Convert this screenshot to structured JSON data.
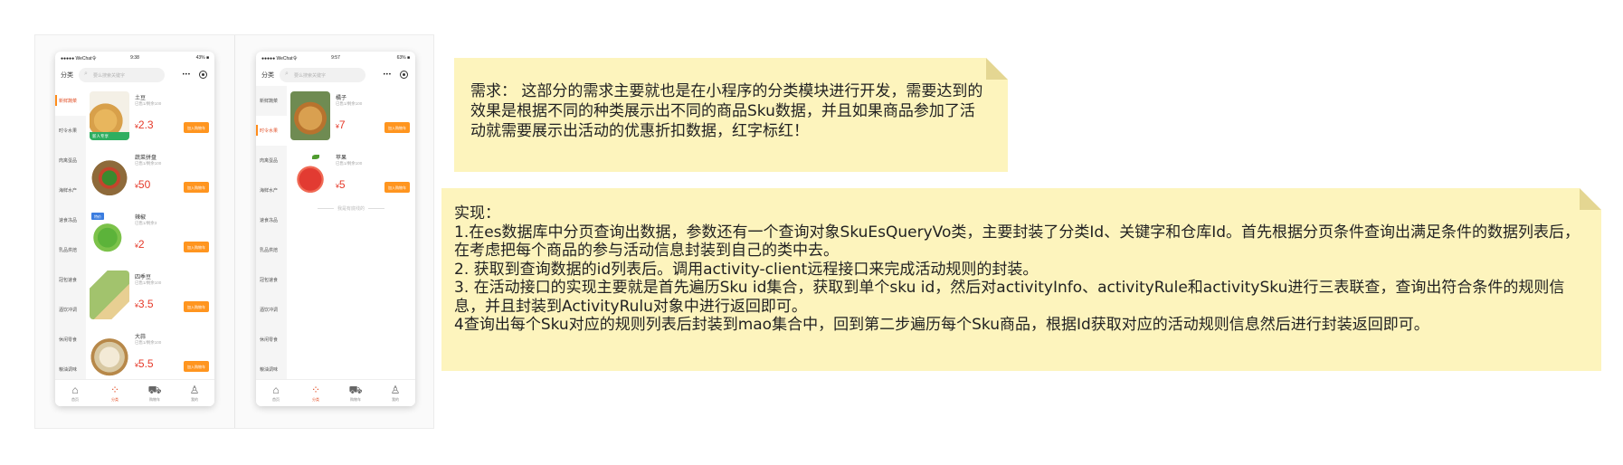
{
  "phones": [
    {
      "status": {
        "carrier": "●●●●● WeChat令",
        "time": "9:38",
        "battery": "43% ■"
      },
      "category_title": "分类",
      "search_placeholder": "要么搜索关键字",
      "capsule_dots": "•••",
      "categories": [
        "新鲜蔬菜",
        "时令水果",
        "肉禽蛋品",
        "海鲜水产",
        "速食冻品",
        "乳品烘焙",
        "冠包速食",
        "酒饮冲调",
        "休闲零食",
        "粮油调味"
      ],
      "active_category_index": 0,
      "products": [
        {
          "name": "土豆",
          "sold": "已售1/剩余100",
          "price": "2.3",
          "tag": "新人专享",
          "img": "img-potato"
        },
        {
          "name": "蔬菜拼盘",
          "sold": "已售1/剩余100",
          "price": "50",
          "img": "img-basket"
        },
        {
          "name": "辣椒",
          "sold": "已售1/剩余3",
          "price": "2",
          "tag_blue": "特价",
          "img": "img-pepper"
        },
        {
          "name": "四季豆",
          "sold": "已售1/剩余100",
          "price": "3.5",
          "img": "img-beans"
        },
        {
          "name": "大蒜",
          "sold": "已售1/剩余100",
          "price": "5.5",
          "img": "img-garlic"
        }
      ],
      "no_more": ""
    },
    {
      "status": {
        "carrier": "●●●●● WeChat令",
        "time": "9:57",
        "battery": "63% ■"
      },
      "category_title": "分类",
      "search_placeholder": "要么搜索关键字",
      "capsule_dots": "•••",
      "categories": [
        "新鲜蔬菜",
        "时令水果",
        "肉禽蛋品",
        "海鲜水产",
        "速食冻品",
        "乳品烘焙",
        "冠包速食",
        "酒饮冲调",
        "休闲零食",
        "粮油调味"
      ],
      "active_category_index": 1,
      "products": [
        {
          "name": "橘子",
          "sold": "已售1/剩余100",
          "price": "7",
          "img": "img-pumpkin"
        },
        {
          "name": "苹果",
          "sold": "已售1/剩余100",
          "price": "5",
          "img": "img-apple"
        }
      ],
      "no_more": "我是有底线的"
    }
  ],
  "add_label": "加入购物车",
  "currency": "¥",
  "tabbar": [
    {
      "label": "首页",
      "icon": "home-icon",
      "glyph": "⌂"
    },
    {
      "label": "分类",
      "icon": "category-icon",
      "glyph": "⁘",
      "active": true
    },
    {
      "label": "购物车",
      "icon": "cart-icon",
      "glyph": "⛟"
    },
    {
      "label": "我的",
      "icon": "user-icon",
      "glyph": "♙"
    }
  ],
  "note1": {
    "text": "需求：   这部分的需求主要就也是在小程序的分类模块进行开发，需要达到的效果是根据不同的种类展示出不同的商品Sku数据，并且如果商品参加了活动就需要展示出活动的优惠折扣数据，红字标红！"
  },
  "note2": {
    "lines": [
      "实现：",
      "1.在es数据库中分页查询出数据，参数还有一个查询对象SkuEsQueryVo类，主要封装了分类Id、关键字和仓库Id。首先根据分页条件查询出满足条件的数据列表后，在考虑把每个商品的参与活动信息封装到自己的类中去。",
      "2. 获取到查询数据的id列表后。调用activity-client远程接口来完成活动规则的封装。",
      "3. 在活动接口的实现主要就是首先遍历Sku id集合，获取到单个sku id，然后对activityInfo、activityRule和activitySku进行三表联查，查询出符合条件的规则信息，并且封装到ActivityRulu对象中进行返回即可。",
      "4查询出每个Sku对应的规则列表后封装到mao集合中，回到第二步遍历每个Sku商品，根据Id获取对应的活动规则信息然后进行封装返回即可。"
    ]
  },
  "colors": {
    "note_bg": "#fdf4bd",
    "accent": "#ff951f",
    "price": "#e53a2a"
  }
}
